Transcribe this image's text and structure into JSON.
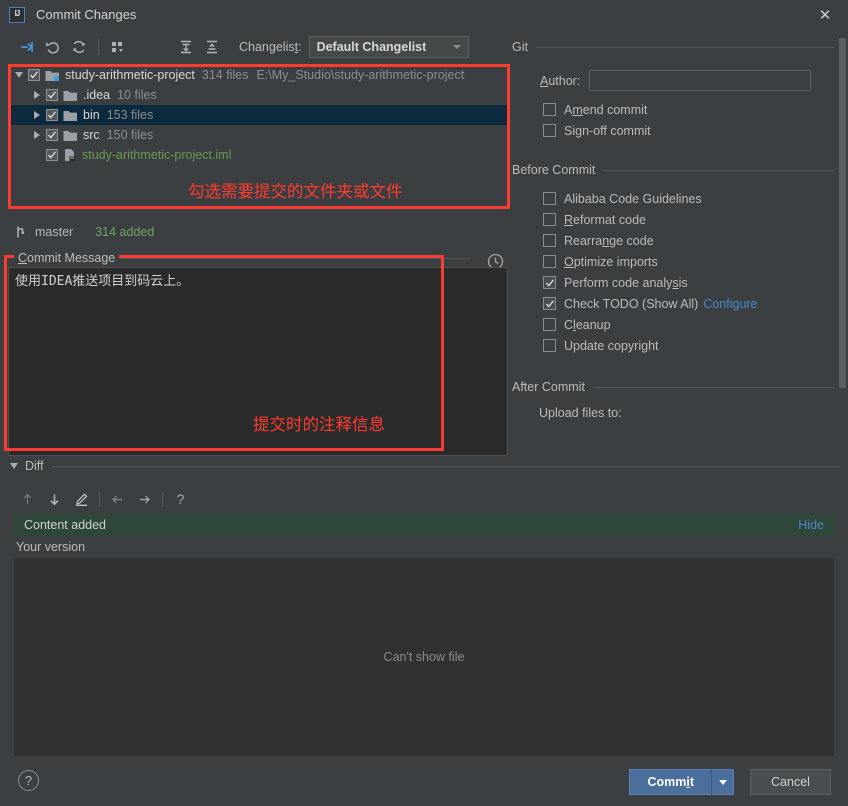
{
  "window": {
    "title": "Commit Changes",
    "logo_text": "IJ",
    "close_label": "✕"
  },
  "toolbar": {
    "icons": [
      {
        "name": "show-diff-icon",
        "label": "Show Diff"
      },
      {
        "name": "revert-icon",
        "label": "Revert"
      },
      {
        "name": "refresh-icon",
        "label": "Refresh"
      },
      {
        "name": "group-by-icon",
        "label": "Group By"
      },
      {
        "name": "expand-all-icon",
        "label": "Expand All"
      },
      {
        "name": "collapse-all-icon",
        "label": "Collapse All"
      }
    ],
    "changelist_label": "Changelist:",
    "changelist_value": "Default Changelist"
  },
  "tree": {
    "rows": [
      {
        "indent": 0,
        "twisty": "down",
        "checked": true,
        "icon": "project-folder-icon",
        "name": "study-arithmetic-project",
        "name_color": "normal",
        "count": "314 files",
        "path": "E:\\My_Studio\\study-arithmetic-project",
        "selected": false
      },
      {
        "indent": 1,
        "twisty": "right",
        "checked": true,
        "icon": "folder-icon",
        "name": ".idea",
        "name_color": "normal",
        "count": "10 files",
        "path": "",
        "selected": false
      },
      {
        "indent": 1,
        "twisty": "right",
        "checked": true,
        "icon": "folder-icon",
        "name": "bin",
        "name_color": "normal",
        "count": "153 files",
        "path": "",
        "selected": true
      },
      {
        "indent": 1,
        "twisty": "right",
        "checked": true,
        "icon": "folder-icon",
        "name": "src",
        "name_color": "normal",
        "count": "150 files",
        "path": "",
        "selected": false
      },
      {
        "indent": 1,
        "twisty": "none",
        "checked": true,
        "icon": "iml-file-icon",
        "name": "study-arithmetic-project.iml",
        "name_color": "green",
        "count": "",
        "path": "",
        "selected": false
      }
    ],
    "annotation": "勾选需要提交的文件夹或文件"
  },
  "branch": {
    "icon": "branch-icon",
    "name": "master",
    "added": "314 added"
  },
  "commit_message": {
    "label": "Commit Message",
    "label_mnemonic": "C",
    "value": "使用IDEA推送项目到码云上。",
    "history_icon": "clock-history-icon",
    "annotation": "提交时的注释信息"
  },
  "git_panel": {
    "section_git": "Git",
    "author_label": "Author:",
    "author_mnemonic": "A",
    "author_value": "",
    "git_checkboxes": [
      {
        "label_pre": "A",
        "label_mn": "m",
        "label_post": "end commit",
        "checked": false,
        "name": "amend-commit-checkbox"
      },
      {
        "label_pre": "Si",
        "label_mn": "g",
        "label_post": "n-off commit",
        "checked": false,
        "name": "sign-off-commit-checkbox"
      }
    ],
    "section_before": "Before Commit",
    "before_checkboxes": [
      {
        "label_pre": "",
        "label_mn": "",
        "label_post": "Alibaba Code Guidelines",
        "checked": false,
        "name": "alibaba-code-guidelines-checkbox"
      },
      {
        "label_pre": "",
        "label_mn": "R",
        "label_post": "eformat code",
        "checked": false,
        "name": "reformat-code-checkbox"
      },
      {
        "label_pre": "Rearra",
        "label_mn": "n",
        "label_post": "ge code",
        "checked": false,
        "name": "rearrange-code-checkbox"
      },
      {
        "label_pre": "",
        "label_mn": "O",
        "label_post": "ptimize imports",
        "checked": false,
        "name": "optimize-imports-checkbox"
      },
      {
        "label_pre": "Perform code analy",
        "label_mn": "s",
        "label_post": "is",
        "checked": true,
        "name": "perform-code-analysis-checkbox"
      },
      {
        "label_pre": "",
        "label_mn": "",
        "label_post": "Check TODO (Show All)",
        "checked": true,
        "name": "check-todo-checkbox",
        "link": "Configure"
      },
      {
        "label_pre": "C",
        "label_mn": "l",
        "label_post": "eanup",
        "checked": false,
        "name": "cleanup-checkbox"
      },
      {
        "label_pre": "",
        "label_mn": "",
        "label_post": "Update copyright",
        "checked": false,
        "name": "update-copyright-checkbox"
      }
    ],
    "section_after": "After Commit",
    "upload_label": "Upload files to:"
  },
  "diff": {
    "section_title": "Diff",
    "toolbar_icons": [
      {
        "name": "previous-difference-icon"
      },
      {
        "name": "next-difference-icon"
      },
      {
        "name": "edit-source-icon"
      },
      {
        "name": "arrow-left-icon"
      },
      {
        "name": "arrow-right-icon"
      },
      {
        "name": "help-question-icon"
      }
    ],
    "status_text": "Content added",
    "hide_label": "Hide",
    "your_version_label": "Your version",
    "empty_text": "Can't show file"
  },
  "bottom": {
    "help_label": "?",
    "commit_label_pre": "Comm",
    "commit_label_mn": "i",
    "commit_label_post": "t",
    "cancel_label": "Cancel"
  },
  "colors": {
    "background": "#3c3f41",
    "editor_background": "#2b2b2b",
    "accent_blue": "#4a88c7",
    "commit_button": "#4a6f9c",
    "annotation_red": "#ff3b30",
    "added_green": "#77a060",
    "diff_added_bar": "#2f4739",
    "selection": "#0d293e"
  }
}
